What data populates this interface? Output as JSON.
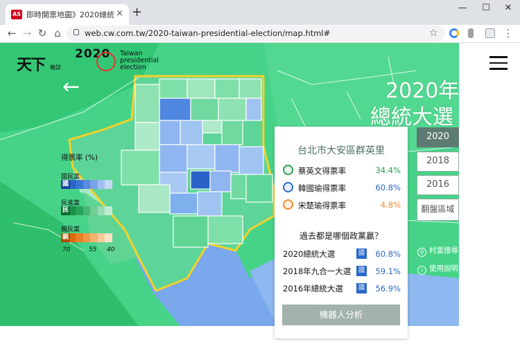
{
  "browser": {
    "tab_favicon": "AS",
    "tab_title": "即時開票地圖》2020總統大選",
    "tab_close": "×",
    "new_tab": "+",
    "window_minimize": "—",
    "window_maximize": "☐",
    "window_close": "✕",
    "back": "←",
    "forward": "→",
    "reload": "↻",
    "home": "⌂",
    "url": "web.cw.com.tw/2020-taiwan-presidential-election/map.html#",
    "bookmark_star": "☆",
    "menu": "⋮"
  },
  "header": {
    "logo_main": "天下",
    "logo_sub": "雜誌",
    "logo_year": "2020",
    "logo_text_line1": "Taiwan",
    "logo_text_line2": "presidential",
    "logo_text_line3": "election",
    "back_arrow": "←"
  },
  "titles": {
    "line1": "2020年",
    "line2": "總統大選"
  },
  "year_buttons": [
    {
      "label": "2020",
      "active": true
    },
    {
      "label": "2018",
      "active": false
    },
    {
      "label": "2016",
      "active": false
    },
    {
      "label": "翻盤區域",
      "active": false
    }
  ],
  "side_links": {
    "search": "村里搜尋",
    "help": "使用說明"
  },
  "legend": {
    "title": "得票率 (%)",
    "kmt_label": "國民黨",
    "kmt_tag": "國",
    "dpp_label": "民進黨",
    "dpp_tag": "民",
    "pfp_label": "親民黨",
    "pfp_tag": "親",
    "ticks": [
      "70",
      "55",
      "40"
    ]
  },
  "panel": {
    "title": "台北市大安區群英里",
    "candidates": [
      {
        "name": "蔡英文得票率",
        "pct": "34.4%",
        "color": "#2a9d50"
      },
      {
        "name": "韓國瑜得票率",
        "pct": "60.8%",
        "color": "#2a68c9"
      },
      {
        "name": "宋楚瑜得票率",
        "pct": "4.8%",
        "color": "#f08a2c"
      }
    ],
    "question": "過去都是哪個政黨贏？",
    "history": [
      {
        "label": "2020總統大選",
        "badge": "國",
        "pct": "60.8%"
      },
      {
        "label": "2018年九合一大選",
        "badge": "國",
        "pct": "59.1%"
      },
      {
        "label": "2016年總統大選",
        "badge": "國",
        "pct": "56.9%"
      }
    ],
    "robot_button": "機器人分析"
  },
  "colors": {
    "kmt": "#2a68c9",
    "dpp": "#2a9d50",
    "pfp": "#f08a2c",
    "map_bg": "#3fcf82",
    "highlight_border": "#f5d12a"
  }
}
